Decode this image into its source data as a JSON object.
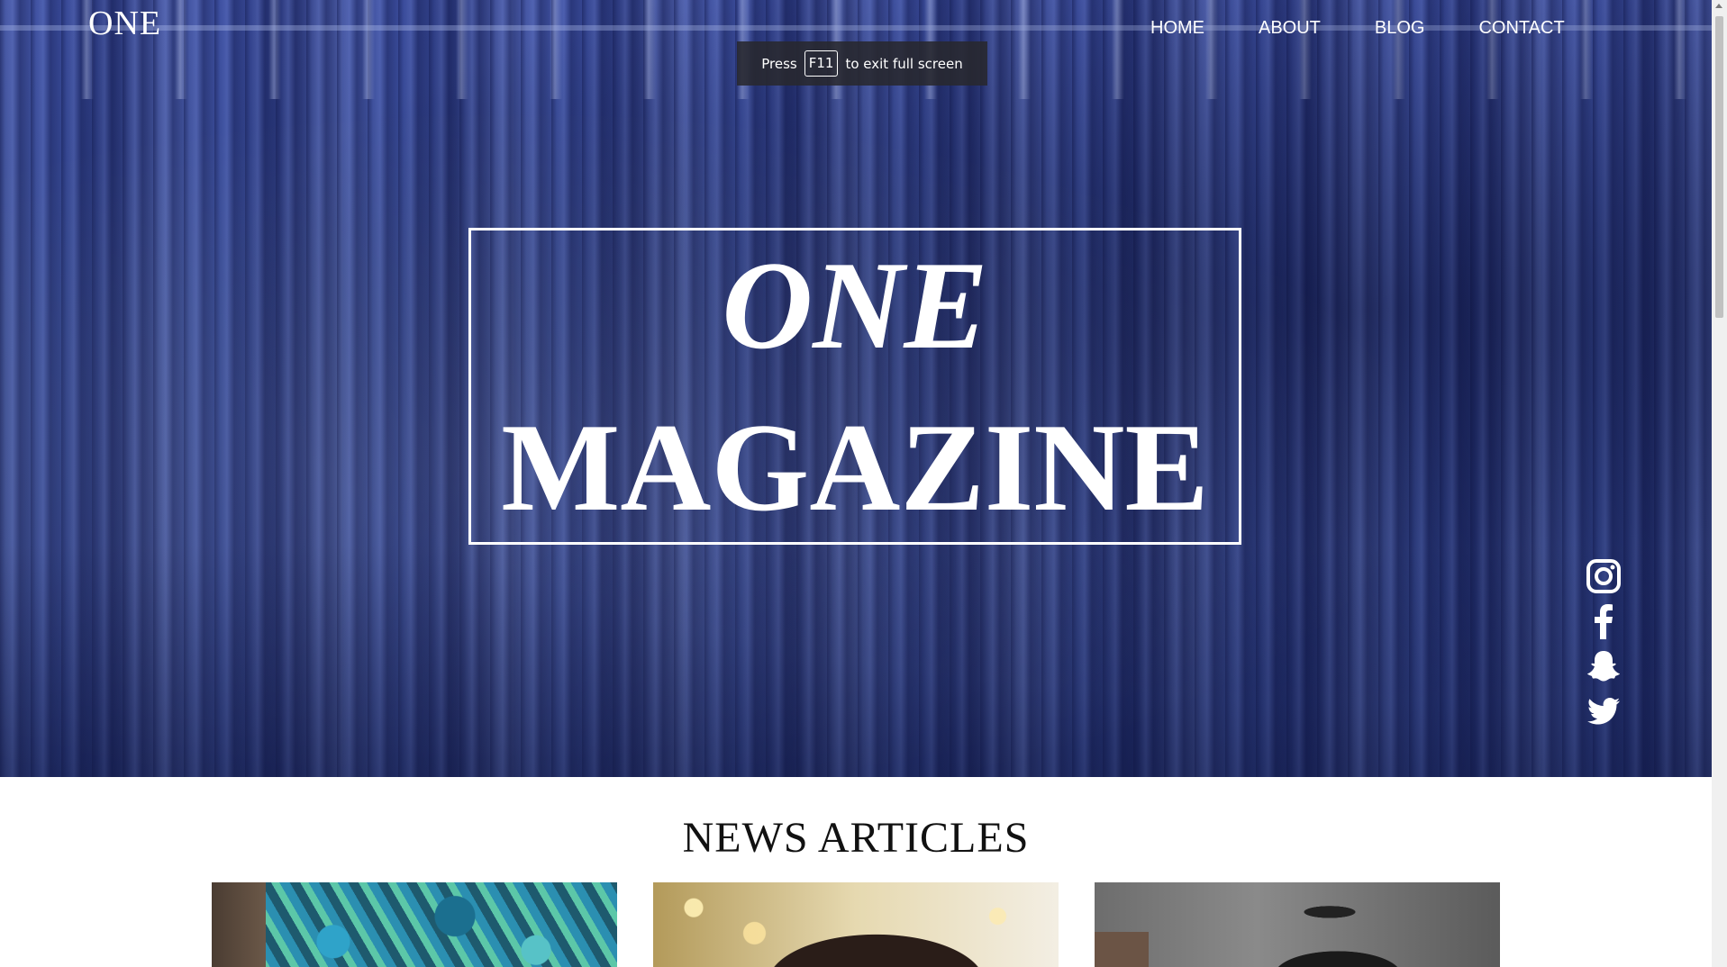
{
  "site": {
    "logo": "ONE"
  },
  "nav": {
    "items": [
      {
        "label": "HOME"
      },
      {
        "label": "ABOUT"
      },
      {
        "label": "BLOG"
      },
      {
        "label": "CONTACT"
      }
    ]
  },
  "fullscreen_notice": {
    "prefix": "Press",
    "key": "F11",
    "suffix": "to exit full screen"
  },
  "hero": {
    "title_line1": "ONE",
    "title_line2": "MAGAZINE"
  },
  "social": {
    "icons": [
      "instagram-icon",
      "facebook-icon",
      "snapchat-icon",
      "twitter-icon"
    ],
    "color": "#ffffff"
  },
  "news": {
    "heading": "NEWS ARTICLES"
  },
  "colors": {
    "hero_tint": "#34478f",
    "text_light": "#ffffff",
    "heading_dark": "#111111"
  }
}
